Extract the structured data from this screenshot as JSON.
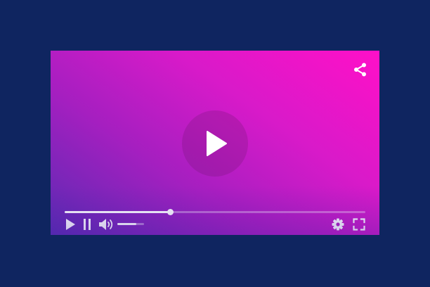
{
  "player": {
    "colors": {
      "background": "#0f2560",
      "gradient_start": "#ff10c8",
      "gradient_end": "#5b2bb3",
      "controls": "#ffffff"
    },
    "icons": {
      "share": "share-icon",
      "center_play": "play-icon",
      "play": "play-icon",
      "pause": "pause-icon",
      "volume": "volume-icon",
      "settings": "gear-icon",
      "fullscreen": "fullscreen-icon"
    },
    "progress_fraction": 0.35,
    "volume_fraction": 0.7
  }
}
